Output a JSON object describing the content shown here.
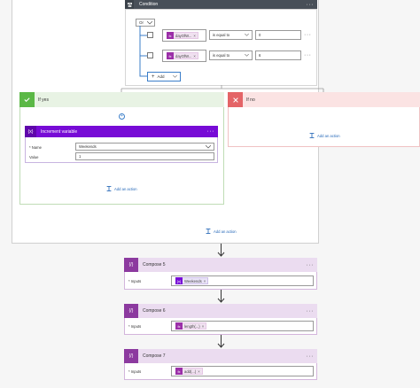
{
  "condition": {
    "title": "Condition",
    "or_label": "Or",
    "rows": [
      {
        "token": "dayOfW...",
        "op": "is equal to",
        "value": "0"
      },
      {
        "token": "dayOfW...",
        "op": "is equal to",
        "value": "6"
      }
    ],
    "add_label": "Add"
  },
  "yes_branch": {
    "title": "If yes",
    "action": {
      "title": "Increment variable",
      "name_label": "* Name",
      "name_value": "Weekends",
      "value_label": "Value",
      "value_value": "1"
    },
    "add_action": "Add an action"
  },
  "no_branch": {
    "title": "If no",
    "add_action": "Add an action"
  },
  "outer_add_action": "Add an action",
  "composes": [
    {
      "title": "Compose 5",
      "inputs_label": "* Inputs",
      "token": "Weekends"
    },
    {
      "title": "Compose 6",
      "inputs_label": "* Inputs",
      "token": "length(...)"
    },
    {
      "title": "Compose 7",
      "inputs_label": "* Inputs",
      "token": "add(...)"
    }
  ],
  "colors": {
    "condition_header": "#484f58",
    "yes_header": "#e8f3e4",
    "yes_accent": "#5bb846",
    "no_header": "#fbe3e3",
    "no_accent": "#e46467",
    "variable": "#770bd6",
    "compose": "#8c3a9f",
    "link": "#2668b8"
  },
  "icons": [
    "condition-icon",
    "check-icon",
    "close-icon",
    "variable-icon",
    "compose-icon",
    "expression-icon",
    "add-action-icon",
    "arrow-down-icon",
    "chevron-down-icon",
    "more-icon"
  ]
}
